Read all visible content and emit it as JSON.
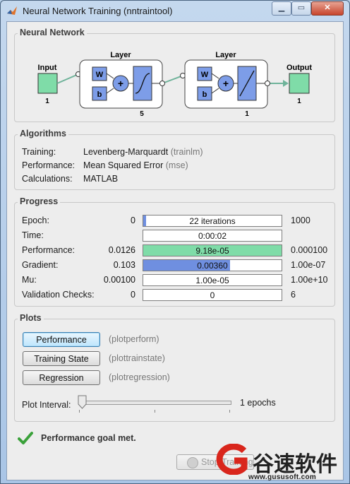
{
  "window": {
    "title": "Neural Network Training (nntraintool)"
  },
  "network": {
    "section_title": "Neural Network",
    "input_label": "Input",
    "input_size": "1",
    "layer1_label": "Layer",
    "layer1_size": "5",
    "layer2_label": "Layer",
    "layer2_size": "1",
    "output_label": "Output",
    "output_size": "1",
    "w_label": "W",
    "b_label": "b"
  },
  "algorithms": {
    "section_title": "Algorithms",
    "rows": [
      {
        "label": "Training:",
        "value": "Levenberg-Marquardt",
        "code": "(trainlm)"
      },
      {
        "label": "Performance:",
        "value": "Mean Squared Error",
        "code": "(mse)"
      },
      {
        "label": "Calculations:",
        "value": "MATLAB",
        "code": ""
      }
    ]
  },
  "progress": {
    "section_title": "Progress",
    "rows": [
      {
        "label": "Epoch:",
        "start": "0",
        "bar_text": "22 iterations",
        "end": "1000",
        "fill": 0.02,
        "color": "#6f8fe0"
      },
      {
        "label": "Time:",
        "start": "",
        "bar_text": "0:00:02",
        "end": "",
        "fill": 0,
        "color": "#ffffff"
      },
      {
        "label": "Performance:",
        "start": "0.0126",
        "bar_text": "9.18e-05",
        "end": "0.000100",
        "fill": 1.0,
        "color": "#7fdca8"
      },
      {
        "label": "Gradient:",
        "start": "0.103",
        "bar_text": "0.00360",
        "end": "1.00e-07",
        "fill": 0.63,
        "color": "#6f8fe0"
      },
      {
        "label": "Mu:",
        "start": "0.00100",
        "bar_text": "1.00e-05",
        "end": "1.00e+10",
        "fill": 0,
        "color": "#6f8fe0"
      },
      {
        "label": "Validation Checks:",
        "start": "0",
        "bar_text": "0",
        "end": "6",
        "fill": 0,
        "color": "#6f8fe0"
      }
    ]
  },
  "plots": {
    "section_title": "Plots",
    "buttons": [
      {
        "label": "Performance",
        "code": "(plotperform)"
      },
      {
        "label": "Training State",
        "code": "(plottrainstate)"
      },
      {
        "label": "Regression",
        "code": "(plotregression)"
      }
    ],
    "interval_label": "Plot Interval:",
    "interval_value": "1 epochs"
  },
  "status": {
    "message": "Performance goal met."
  },
  "footer": {
    "stop_label": "Stop Training"
  },
  "watermark": {
    "text": "谷速软件",
    "domain": "www.gususoft.com"
  },
  "colors": {
    "node_green": "#7fdca8",
    "block_blue": "#7d9de8",
    "check_green": "#3aa13a"
  }
}
